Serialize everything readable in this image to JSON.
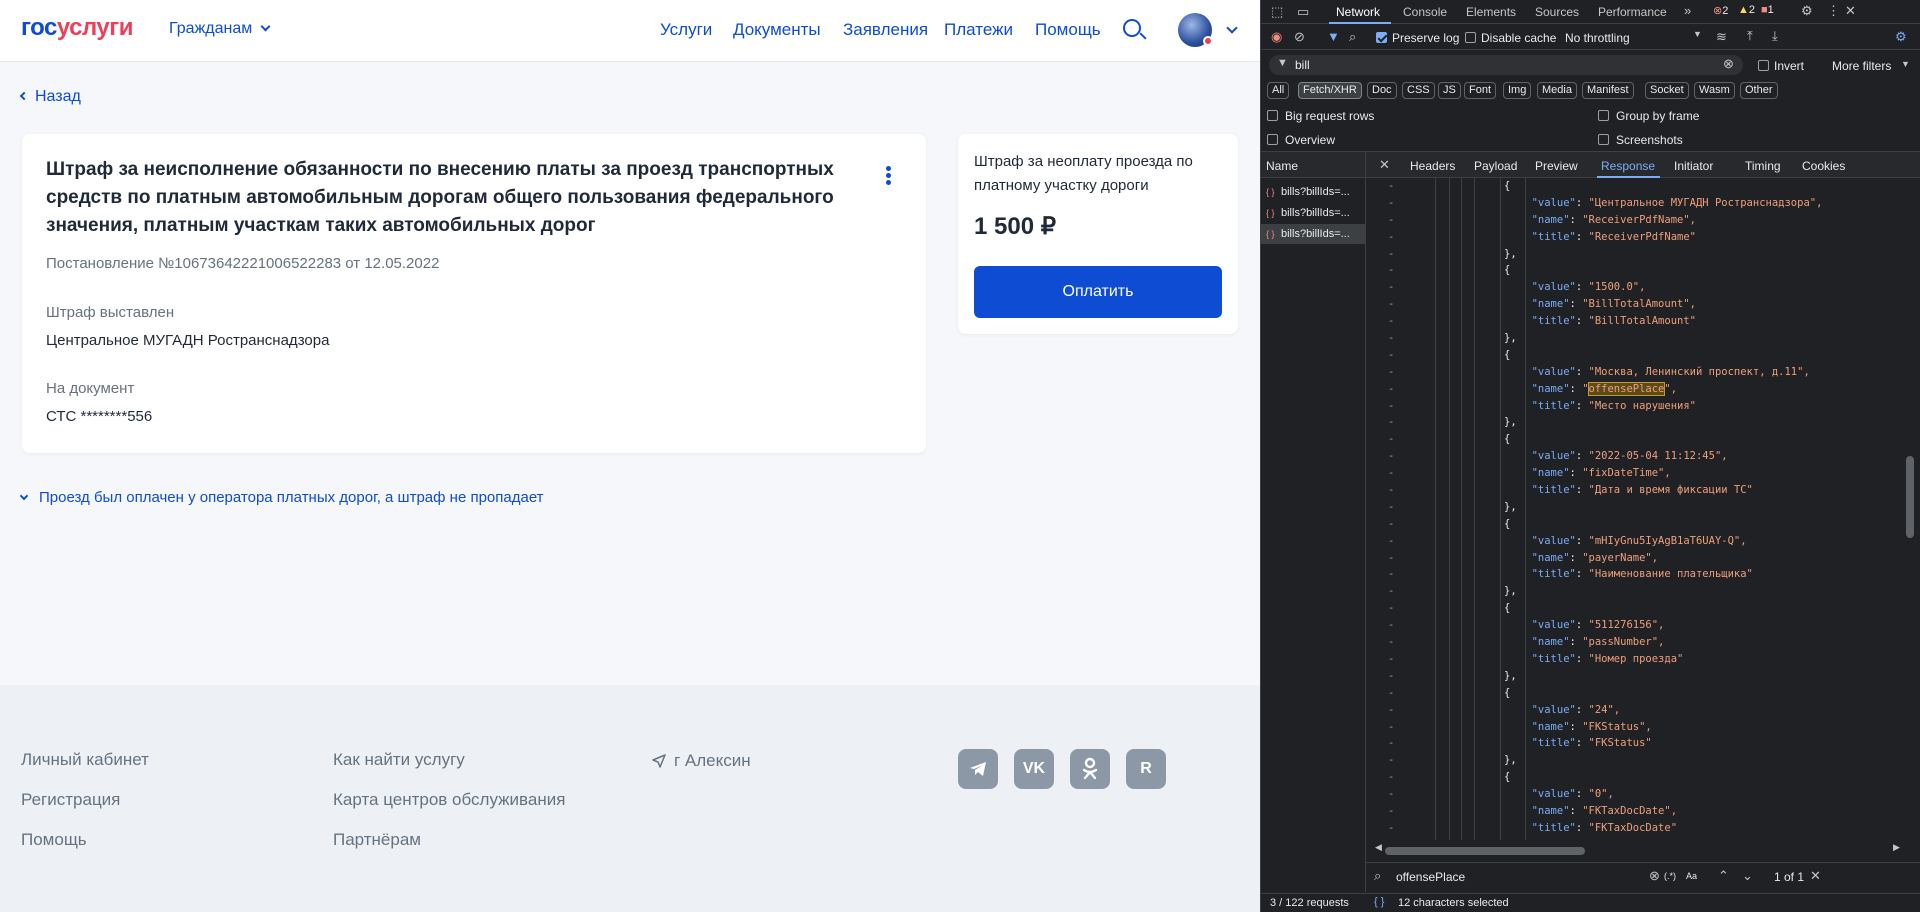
{
  "site": {
    "logo": {
      "part1": "гос",
      "part2": "услуги"
    },
    "citizens_menu": "Гражданам",
    "nav": [
      "Услуги",
      "Документы",
      "Заявления",
      "Платежи",
      "Помощь"
    ],
    "back": "Назад",
    "fine": {
      "title": "Штраф за неисполнение обязанности по внесению платы за проезд транспортных средств по платным автомобильным дорогам общего пользования федерального значения, платным участкам таких автомобильных дорог",
      "decree": "Постановление №10673642221006522283 от 12.05.2022",
      "issued_label": "Штраф выставлен",
      "issued_value": "Центральное МУГАДН Ространснадзора",
      "doc_label": "На документ",
      "doc_value": "СТС ********556"
    },
    "pay": {
      "desc": "Штраф за неоплату проезда по платному участку дороги",
      "amount": "1 500 ₽",
      "button": "Оплатить"
    },
    "expand_link": "Проезд был оплачен у оператора платных дорог, а штраф не пропадает",
    "footer": {
      "col1": [
        "Личный кабинет",
        "Регистрация",
        "Помощь"
      ],
      "col2": [
        "Как найти услугу",
        "Карта центров обслуживания",
        "Партнёрам"
      ],
      "location": "г Алексин",
      "socials": [
        "telegram-icon",
        "vk-icon",
        "ok-icon",
        "rutube-icon"
      ]
    },
    "colors": {
      "brand_blue": "#0d4cd3",
      "brand_red": "#ee3f58"
    }
  },
  "devtools": {
    "tabs": [
      "Network",
      "Console",
      "Elements",
      "Sources",
      "Performance"
    ],
    "active_tab": "Network",
    "badges": {
      "errors": "2",
      "warnings": "2",
      "issues": "1"
    },
    "toolbar": {
      "preserve_log": "Preserve log",
      "disable_cache": "Disable cache",
      "throttling": "No throttling"
    },
    "filter": {
      "value": "bill",
      "invert": "Invert",
      "more_filters": "More filters"
    },
    "type_filters": [
      "All",
      "Fetch/XHR",
      "Doc",
      "CSS",
      "JS",
      "Font",
      "Img",
      "Media",
      "Manifest",
      "Socket",
      "Wasm",
      "Other"
    ],
    "options": {
      "big_rows": "Big request rows",
      "group_frame": "Group by frame",
      "overview": "Overview",
      "screenshots": "Screenshots"
    },
    "name_header": "Name",
    "detail_tabs": [
      "Headers",
      "Payload",
      "Preview",
      "Response",
      "Initiator",
      "Timing",
      "Cookies"
    ],
    "active_detail_tab": "Response",
    "requests": [
      "bills?billIds=...",
      "bills?billIds=...",
      "bills?billIds=..."
    ],
    "json_lines": [
      {
        "indent": 10,
        "kind": "open",
        "text": "{"
      },
      {
        "indent": 12,
        "kind": "kv",
        "key": "\"value\"",
        "val": "\"Центральное МУГАДН Ространснадзора\","
      },
      {
        "indent": 12,
        "kind": "kv",
        "key": "\"name\"",
        "val": "\"ReceiverPdfName\","
      },
      {
        "indent": 12,
        "kind": "kv",
        "key": "\"title\"",
        "val": "\"ReceiverPdfName\""
      },
      {
        "indent": 10,
        "kind": "close",
        "text": "},"
      },
      {
        "indent": 10,
        "kind": "open",
        "text": "{"
      },
      {
        "indent": 12,
        "kind": "kv",
        "key": "\"value\"",
        "val": "\"1500.0\","
      },
      {
        "indent": 12,
        "kind": "kv",
        "key": "\"name\"",
        "val": "\"BillTotalAmount\","
      },
      {
        "indent": 12,
        "kind": "kv",
        "key": "\"title\"",
        "val": "\"BillTotalAmount\""
      },
      {
        "indent": 10,
        "kind": "close",
        "text": "},"
      },
      {
        "indent": 10,
        "kind": "open",
        "text": "{"
      },
      {
        "indent": 12,
        "kind": "kv",
        "key": "\"value\"",
        "val": "\"Москва, Ленинский проспект, д.11\","
      },
      {
        "indent": 12,
        "kind": "hl",
        "key": "\"name\"",
        "pre": "\"",
        "mark": "offensePlace",
        "post": "\","
      },
      {
        "indent": 12,
        "kind": "kv",
        "key": "\"title\"",
        "val": "\"Место нарушения\""
      },
      {
        "indent": 10,
        "kind": "close",
        "text": "},"
      },
      {
        "indent": 10,
        "kind": "open",
        "text": "{"
      },
      {
        "indent": 12,
        "kind": "kv",
        "key": "\"value\"",
        "val": "\"2022-05-04 11:12:45\","
      },
      {
        "indent": 12,
        "kind": "kv",
        "key": "\"name\"",
        "val": "\"fixDateTime\","
      },
      {
        "indent": 12,
        "kind": "kv",
        "key": "\"title\"",
        "val": "\"Дата и время фиксации ТС\""
      },
      {
        "indent": 10,
        "kind": "close",
        "text": "},"
      },
      {
        "indent": 10,
        "kind": "open",
        "text": "{"
      },
      {
        "indent": 12,
        "kind": "kv",
        "key": "\"value\"",
        "val": "\"mHIyGnu5IyAgB1aT6UAY-Q\","
      },
      {
        "indent": 12,
        "kind": "kv",
        "key": "\"name\"",
        "val": "\"payerName\","
      },
      {
        "indent": 12,
        "kind": "kv",
        "key": "\"title\"",
        "val": "\"Наименование плательщика\""
      },
      {
        "indent": 10,
        "kind": "close",
        "text": "},"
      },
      {
        "indent": 10,
        "kind": "open",
        "text": "{"
      },
      {
        "indent": 12,
        "kind": "kv",
        "key": "\"value\"",
        "val": "\"511276156\","
      },
      {
        "indent": 12,
        "kind": "kv",
        "key": "\"name\"",
        "val": "\"passNumber\","
      },
      {
        "indent": 12,
        "kind": "kv",
        "key": "\"title\"",
        "val": "\"Номер проезда\""
      },
      {
        "indent": 10,
        "kind": "close",
        "text": "},"
      },
      {
        "indent": 10,
        "kind": "open",
        "text": "{"
      },
      {
        "indent": 12,
        "kind": "kv",
        "key": "\"value\"",
        "val": "\"24\","
      },
      {
        "indent": 12,
        "kind": "kv",
        "key": "\"name\"",
        "val": "\"FKStatus\","
      },
      {
        "indent": 12,
        "kind": "kv",
        "key": "\"title\"",
        "val": "\"FKStatus\""
      },
      {
        "indent": 10,
        "kind": "close",
        "text": "},"
      },
      {
        "indent": 10,
        "kind": "open",
        "text": "{"
      },
      {
        "indent": 12,
        "kind": "kv",
        "key": "\"value\"",
        "val": "\"0\","
      },
      {
        "indent": 12,
        "kind": "kv",
        "key": "\"name\"",
        "val": "\"FKTaxDocDate\","
      },
      {
        "indent": 12,
        "kind": "kv",
        "key": "\"title\"",
        "val": "\"FKTaxDocDate\""
      },
      {
        "indent": 10,
        "kind": "close",
        "text": "},"
      }
    ],
    "search": {
      "value": "offensePlace",
      "regex": "(.*)",
      "case": "Aa",
      "count": "1 of 1"
    },
    "status": {
      "requests": "3 / 122 requests",
      "selection": "12 characters selected"
    }
  }
}
